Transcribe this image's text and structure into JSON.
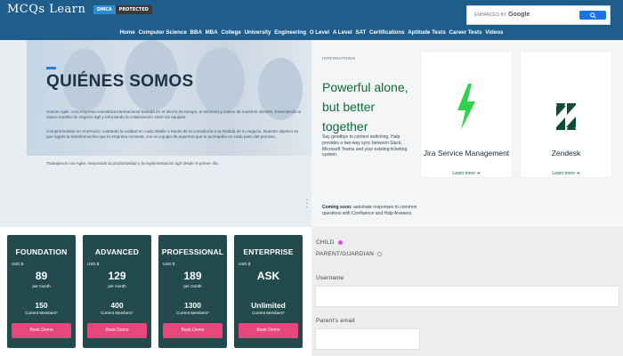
{
  "header": {
    "logo": "MCQs Learn",
    "dmca_a": "DMCA",
    "dmca_b": "PROTECTED",
    "search_enhanced": "ENHANCED BY",
    "search_brand": "Google",
    "search_button_icon": "search-icon",
    "nav": [
      "Home",
      "Computer Science",
      "BBA",
      "MBA",
      "College",
      "University",
      "Engineering",
      "O Level",
      "A Level",
      "SAT",
      "Certifications",
      "Aptitude Tests",
      "Career Tests",
      "Videos"
    ]
  },
  "about": {
    "title": "QUIÉNES SOMOS",
    "para1": "Somos Agile. Una empresa consultora internacional basada en el ahorro de tiempo, el esfuerzo y costos de nuestros clientes, fomentando tu nuevo modelo de negocio ágil y reforzando la colaboración entre los equipos.",
    "para2": "Comprometidos en el servicio, cuidando la calidad en cada detalle a través de la consultoría a la medida de tu negocio. Nuestro objetivo es que logres la transformación que tu empresa necesita, con un equipo de expertos que te acompaña en cada paso del proceso.",
    "para3": "Trabajamos con Agile, mejorando la productividad y la implementación ágil desde el primer día."
  },
  "pricing": {
    "currency": "USD $",
    "per": "per month",
    "members_label": "Current Members*",
    "demo_label": "Book Demo",
    "plans": [
      {
        "name": "FOUNDATION",
        "price": "89",
        "members": "150"
      },
      {
        "name": "ADVANCED",
        "price": "129",
        "members": "400"
      },
      {
        "name": "PROFESSIONAL",
        "price": "189",
        "members": "1300"
      },
      {
        "name": "ENTERPRISE",
        "price": "ASK",
        "members": "Unlimited"
      }
    ]
  },
  "integrations": {
    "tag": "INTEGRATIONS",
    "title": "Powerful alone, but better together",
    "description": "Say goodbye to context switching. Halp provides a two-way sync between Slack, Microsoft Teams and your existing ticketing system.",
    "soon_bold": "Coming soon:",
    "soon_text": " automate responses to common questions with Confluence and Halp Answers.",
    "learn_more": "Learn more ➔",
    "cards": [
      {
        "name": "Jira Service Management",
        "icon": "bolt-icon",
        "color": "#2fd24a"
      },
      {
        "name": "Zendesk",
        "icon": "zendesk-icon",
        "color": "#0c4e36"
      }
    ]
  },
  "form": {
    "child": "CHILD",
    "parent": "PARENT/GUARDIAN",
    "username_label": "Username",
    "parent_email_label": "Parent's email"
  },
  "colors": {
    "header_bg": "#1e5d8c",
    "plan_bg": "#234b4d",
    "demo_button": "#e8477c",
    "integration_green": "#0f6b3a",
    "radio_selected": "#d84ce0"
  }
}
